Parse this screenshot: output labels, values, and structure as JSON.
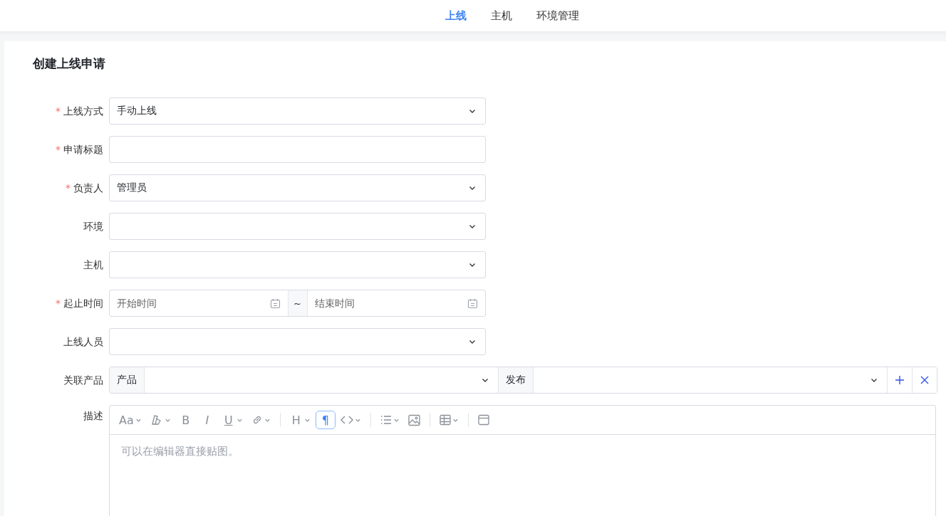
{
  "nav": {
    "tabs": [
      {
        "label": "上线",
        "selected": true
      },
      {
        "label": "主机",
        "selected": false
      },
      {
        "label": "环境管理",
        "selected": false
      }
    ]
  },
  "form": {
    "title": "创建上线申请",
    "fields": [
      {
        "kind": "select",
        "label": "上线方式",
        "required_mark": "*",
        "value": "手动上线"
      },
      {
        "kind": "input",
        "label": "申请标题",
        "required_mark": "*"
      },
      {
        "kind": "select",
        "label": "负责人",
        "required_mark": "*",
        "value": "管理员"
      },
      {
        "kind": "select",
        "label": "环境"
      },
      {
        "kind": "select",
        "label": "主机"
      },
      {
        "kind": "daterange",
        "label": "起止时间",
        "required_mark": "*",
        "start_placeholder": "开始时间",
        "separator": "~",
        "end_placeholder": "结束时间"
      },
      {
        "kind": "select",
        "label": "上线人员"
      },
      {
        "kind": "linked",
        "label": "关联产品",
        "product_label": "产品",
        "release_label": "发布"
      }
    ],
    "description": {
      "label": "描述",
      "placeholder": "可以在编辑器直接贴图。",
      "toolbar": [
        {
          "kind": "font",
          "glyph": "Aa",
          "dropdown": true,
          "selected": false
        },
        {
          "kind": "color",
          "dropdown": true,
          "selected": false
        },
        {
          "kind": "bold",
          "glyph": "B",
          "dropdown": false,
          "selected": false
        },
        {
          "kind": "italic",
          "glyph": "I",
          "dropdown": false,
          "selected": false
        },
        {
          "kind": "underline",
          "glyph": "U",
          "dropdown": true,
          "selected": false
        },
        {
          "kind": "link",
          "dropdown": true,
          "selected": false
        },
        {
          "kind": "divider"
        },
        {
          "kind": "heading",
          "glyph": "H",
          "dropdown": true,
          "selected": false
        },
        {
          "kind": "paragraph",
          "glyph": "¶",
          "dropdown": false,
          "selected": true
        },
        {
          "kind": "code",
          "dropdown": true,
          "selected": false
        },
        {
          "kind": "divider"
        },
        {
          "kind": "list",
          "dropdown": true,
          "selected": false
        },
        {
          "kind": "image",
          "dropdown": false,
          "selected": false
        },
        {
          "kind": "divider"
        },
        {
          "kind": "table",
          "dropdown": true,
          "selected": false
        },
        {
          "kind": "divider"
        },
        {
          "kind": "panel",
          "dropdown": false,
          "selected": false
        }
      ]
    }
  }
}
